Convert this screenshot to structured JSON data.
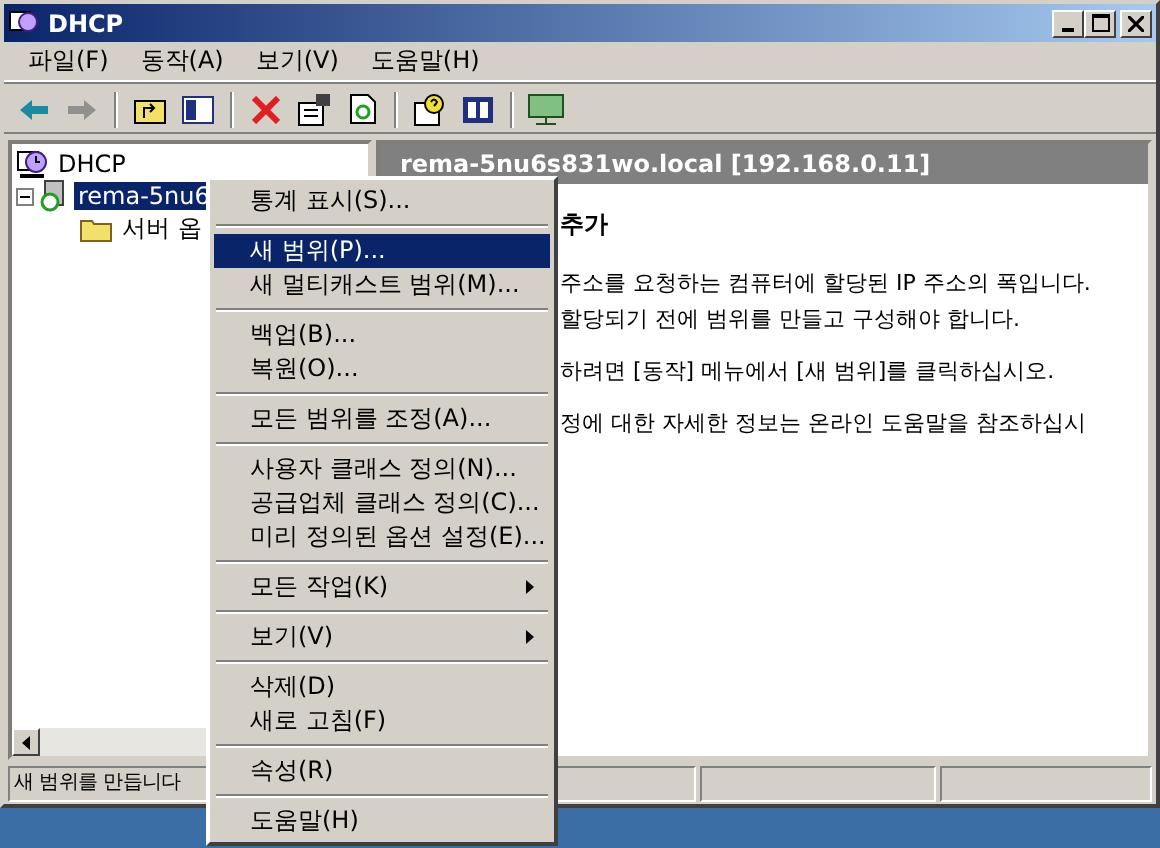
{
  "window": {
    "title": "DHCP"
  },
  "menu_bar": [
    {
      "label": "파일(F)"
    },
    {
      "label": "동작(A)"
    },
    {
      "label": "보기(V)"
    },
    {
      "label": "도움말(H)"
    }
  ],
  "toolbar": [
    {
      "kind": "back",
      "disabled": false
    },
    {
      "kind": "forward",
      "disabled": true
    },
    {
      "kind": "separator"
    },
    {
      "kind": "up"
    },
    {
      "kind": "tree"
    },
    {
      "kind": "separator"
    },
    {
      "kind": "delete"
    },
    {
      "kind": "properties"
    },
    {
      "kind": "export"
    },
    {
      "kind": "separator"
    },
    {
      "kind": "help"
    },
    {
      "kind": "pane"
    },
    {
      "kind": "separator"
    },
    {
      "kind": "monitor"
    }
  ],
  "tree": [
    {
      "label": "DHCP",
      "selected": false,
      "expanded": true,
      "children": [
        {
          "label": "rema-5nu6",
          "selected": true,
          "expanded": true,
          "children": [
            {
              "label": "서버 옵",
              "selected": false
            }
          ]
        }
      ]
    }
  ],
  "details": {
    "header": "rema-5nu6s831wo.local [192.168.0.11]",
    "title": "추가",
    "lines": [
      "주소를 요청하는 컴퓨터에 할당된 IP 주소의 폭입니다.",
      "할당되기 전에 범위를 만들고 구성해야 합니다.",
      "하려면 [동작] 메뉴에서 [새 범위]를 클릭하십시오.",
      "정에 대한 자세한 정보는 온라인 도움말을 참조하십시"
    ]
  },
  "context_menu": [
    [
      {
        "label": "통계 표시(S)...",
        "selected": false,
        "submenu": false
      }
    ],
    [
      {
        "label": "새 범위(P)...",
        "selected": true,
        "submenu": false
      },
      {
        "label": "새 멀티캐스트 범위(M)...",
        "selected": false,
        "submenu": false
      }
    ],
    [
      {
        "label": "백업(B)...",
        "selected": false,
        "submenu": false
      },
      {
        "label": "복원(O)...",
        "selected": false,
        "submenu": false
      }
    ],
    [
      {
        "label": "모든 범위를 조정(A)...",
        "selected": false,
        "submenu": false
      }
    ],
    [
      {
        "label": "사용자 클래스 정의(N)...",
        "selected": false,
        "submenu": false
      },
      {
        "label": "공급업체 클래스 정의(C)...",
        "selected": false
      },
      {
        "label": "미리 정의된 옵션 설정(E)...",
        "selected": false
      }
    ],
    [
      {
        "label": "모든 작업(K)",
        "selected": false,
        "submenu": true
      }
    ],
    [
      {
        "label": "보기(V)",
        "selected": false,
        "submenu": true
      }
    ],
    [
      {
        "label": "삭제(D)",
        "selected": false,
        "submenu": false
      },
      {
        "label": "새로 고침(F)",
        "selected": false,
        "submenu": false
      }
    ],
    [
      {
        "label": "속성(R)",
        "selected": false,
        "submenu": false
      }
    ],
    [
      {
        "label": "도움말(H)",
        "selected": false,
        "submenu": false
      }
    ]
  ],
  "status_bar": {
    "text": "새 범위를 만듭니다"
  }
}
